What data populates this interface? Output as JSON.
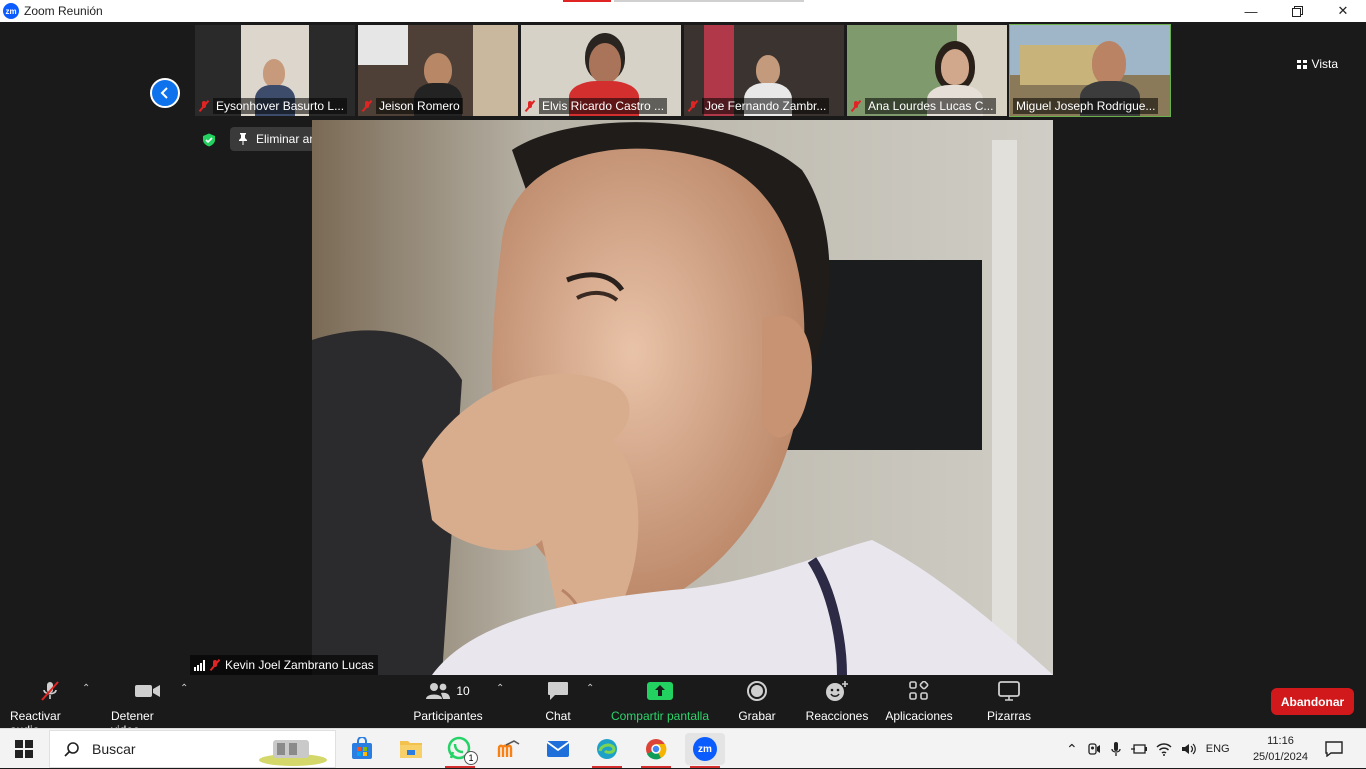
{
  "window": {
    "title": "Zoom Reunión"
  },
  "view": {
    "label": "Vista"
  },
  "participants_strip": [
    {
      "name": "Eysonhover Basurto L...",
      "bg": "#d9d4cb",
      "skin": "#c69a7b"
    },
    {
      "name": "Jeison Romero",
      "bg": "#5b4a3a",
      "skin": "#b88766"
    },
    {
      "name": "Elvis Ricardo Castro ...",
      "bg": "#d7d2c8",
      "skin": "#a97459"
    },
    {
      "name": "Joe Fernando Zambr...",
      "bg": "#3b3330",
      "skin": "#c49a7c"
    },
    {
      "name": "Ana Lourdes Lucas C...",
      "bg": "#8da67a",
      "skin": "#d2a88c"
    },
    {
      "name": "Miguel Joseph Rodrigue...",
      "bg": "#9fb6c8",
      "skin": "#b98364"
    }
  ],
  "pin": {
    "unpin_label": "Eliminar anclaje"
  },
  "main_speaker": {
    "name": "Kevin Joel Zambrano Lucas"
  },
  "toolbar": {
    "audio_label": "Reactivar audio",
    "video_label": "Detener video",
    "participants_label": "Participantes",
    "participants_count": "10",
    "chat_label": "Chat",
    "share_label": "Compartir pantalla",
    "record_label": "Grabar",
    "reactions_label": "Reacciones",
    "apps_label": "Aplicaciones",
    "whiteboards_label": "Pizarras",
    "leave_label": "Abandonar"
  },
  "taskbar": {
    "search_placeholder": "Buscar",
    "whatsapp_badge": "1",
    "lang": "ENG",
    "time": "11:16",
    "date": "25/01/2024"
  }
}
